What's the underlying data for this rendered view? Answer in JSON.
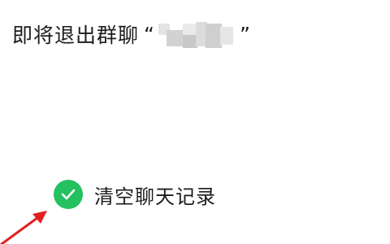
{
  "dialog": {
    "message": "即将退出群聊",
    "quote_open": "“",
    "quote_close": "”",
    "group_name_redacted": true
  },
  "option": {
    "label": "清空聊天记录",
    "checked": true,
    "check_color": "#23c160"
  },
  "icons": {
    "check": "check-icon",
    "arrow": "red-arrow-annotation"
  },
  "colors": {
    "text": "#1c1c1c",
    "accent": "#23c160",
    "annotation": "#e02020"
  }
}
